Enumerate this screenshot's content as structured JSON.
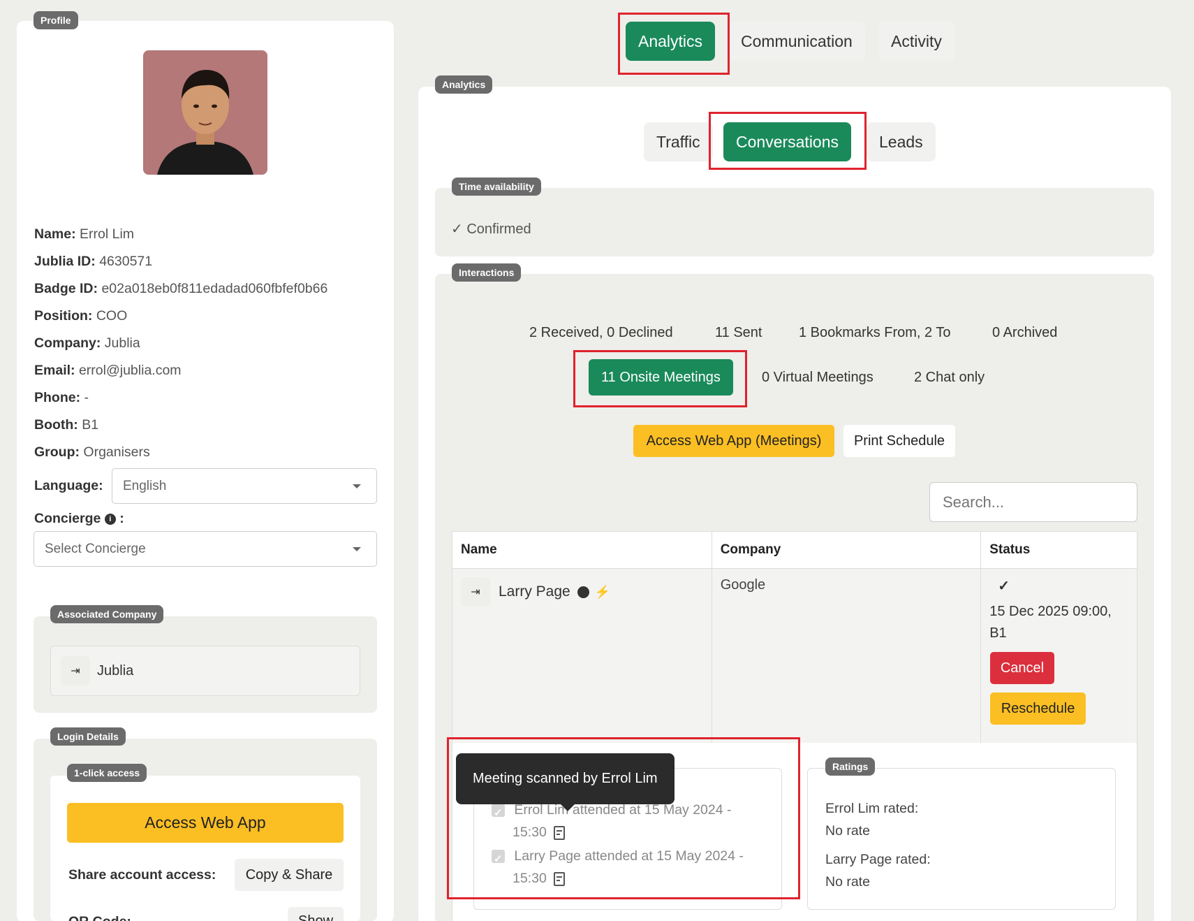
{
  "profile": {
    "pill": "Profile",
    "fields": [
      {
        "label": "Name:",
        "value": "Errol Lim"
      },
      {
        "label": "Jublia ID:",
        "value": "4630571"
      },
      {
        "label": "Badge ID:",
        "value": "e02a018eb0f811edadad060fbfef0b66"
      },
      {
        "label": "Position:",
        "value": "COO"
      },
      {
        "label": "Company:",
        "value": "Jublia"
      },
      {
        "label": "Email:",
        "value": "errol@jublia.com"
      },
      {
        "label": "Phone:",
        "value": "-"
      },
      {
        "label": "Booth:",
        "value": "B1"
      },
      {
        "label": "Group:",
        "value": "Organisers"
      }
    ],
    "language_label": "Language:",
    "language_value": "English",
    "concierge_label": "Concierge",
    "concierge_colon": ":",
    "concierge_placeholder": "Select Concierge",
    "associated_company_pill": "Associated Company",
    "associated_company": "Jublia",
    "login_details_pill": "Login Details",
    "one_click_pill": "1-click access",
    "access_web_app": "Access Web App",
    "share_label": "Share account access:",
    "copy_share": "Copy & Share",
    "qr_label": "QR Code:",
    "show_label": "Show"
  },
  "tabs": {
    "main": [
      "Analytics",
      "Communication",
      "Activity"
    ],
    "analytics_pill": "Analytics",
    "sub": [
      "Traffic",
      "Conversations",
      "Leads"
    ]
  },
  "time_availability": {
    "pill": "Time availability",
    "status": "✓  Confirmed"
  },
  "interactions": {
    "pill": "Interactions",
    "chips_row1": [
      "2 Received, 0 Declined",
      "11 Sent",
      "1 Bookmarks From, 2 To",
      "0 Archived"
    ],
    "chips_row2": [
      "11 Onsite Meetings",
      "0 Virtual Meetings",
      "2 Chat only"
    ],
    "access_meetings": "Access Web App (Meetings)",
    "print_schedule": "Print Schedule",
    "search_placeholder": "Search..."
  },
  "table": {
    "headers": [
      "Name",
      "Company",
      "Status"
    ],
    "row": {
      "name": "Larry Page",
      "company": "Google",
      "check": "✓",
      "datetime": "15 Dec 2025 09:00,",
      "booth": "B1",
      "cancel": "Cancel",
      "reschedule": "Reschedule"
    }
  },
  "attendance": {
    "tooltip": "Meeting scanned by Errol Lim",
    "lines": [
      {
        "text": "Errol Lim attended at 15 May 2024 -",
        "time": "15:30"
      },
      {
        "text": "Larry Page attended at 15 May 2024 -",
        "time": "15:30"
      }
    ]
  },
  "ratings": {
    "pill": "Ratings",
    "items": [
      {
        "who": "Errol Lim rated:",
        "value": "No rate"
      },
      {
        "who": "Larry Page rated:",
        "value": "No rate"
      }
    ]
  },
  "colors": {
    "accent_green": "#1a8a5a",
    "highlight_red": "#e0232e",
    "button_yellow": "#fbbf24",
    "cancel_red": "#dc2f3d"
  }
}
